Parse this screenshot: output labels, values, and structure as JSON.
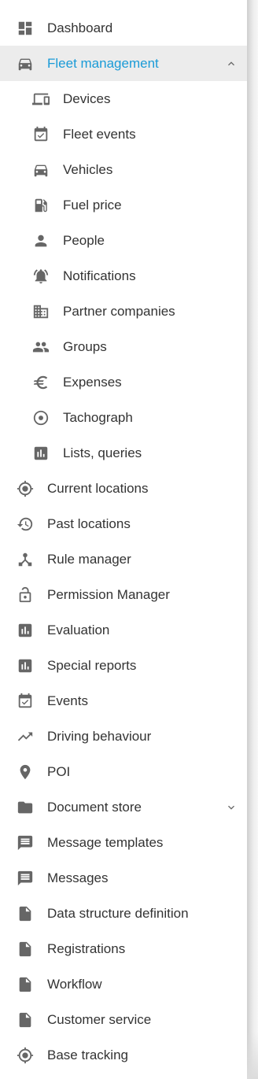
{
  "nav": {
    "items": [
      {
        "label": "Dashboard",
        "icon": "dashboard-icon",
        "level": "top",
        "name": "nav-item-dashboard"
      },
      {
        "label": "Fleet management",
        "icon": "car-icon",
        "level": "top",
        "name": "nav-item-fleet-management",
        "active": true,
        "chevron": "chevron-up-icon"
      },
      {
        "label": "Devices",
        "icon": "devices-icon",
        "level": "sub",
        "name": "nav-item-devices"
      },
      {
        "label": "Fleet events",
        "icon": "event-calendar-icon",
        "level": "sub",
        "name": "nav-item-fleet-events"
      },
      {
        "label": "Vehicles",
        "icon": "car-icon",
        "level": "sub",
        "name": "nav-item-vehicles"
      },
      {
        "label": "Fuel price",
        "icon": "fuel-pump-icon",
        "level": "sub",
        "name": "nav-item-fuel-price"
      },
      {
        "label": "People",
        "icon": "person-icon",
        "level": "sub",
        "name": "nav-item-people"
      },
      {
        "label": "Notifications",
        "icon": "notification-bell-icon",
        "level": "sub",
        "name": "nav-item-notifications"
      },
      {
        "label": "Partner companies",
        "icon": "building-icon",
        "level": "sub",
        "name": "nav-item-partner-companies"
      },
      {
        "label": "Groups",
        "icon": "group-icon",
        "level": "sub",
        "name": "nav-item-groups"
      },
      {
        "label": "Expenses",
        "icon": "euro-icon",
        "level": "sub",
        "name": "nav-item-expenses"
      },
      {
        "label": "Tachograph",
        "icon": "radio-target-icon",
        "level": "sub",
        "name": "nav-item-tachograph"
      },
      {
        "label": "Lists, queries",
        "icon": "bar-chart-icon",
        "level": "sub",
        "name": "nav-item-lists-queries"
      },
      {
        "label": "Current locations",
        "icon": "gps-fixed-icon",
        "level": "top",
        "name": "nav-item-current-locations"
      },
      {
        "label": "Past locations",
        "icon": "history-icon",
        "level": "top",
        "name": "nav-item-past-locations"
      },
      {
        "label": "Rule manager",
        "icon": "hub-icon",
        "level": "top",
        "name": "nav-item-rule-manager"
      },
      {
        "label": "Permission Manager",
        "icon": "lock-open-icon",
        "level": "top",
        "name": "nav-item-permission-manager"
      },
      {
        "label": "Evaluation",
        "icon": "bar-chart-icon",
        "level": "top",
        "name": "nav-item-evaluation"
      },
      {
        "label": "Special reports",
        "icon": "bar-chart-icon",
        "level": "top",
        "name": "nav-item-special-reports"
      },
      {
        "label": "Events",
        "icon": "event-calendar-icon",
        "level": "top",
        "name": "nav-item-events"
      },
      {
        "label": "Driving behaviour",
        "icon": "trending-up-icon",
        "level": "top",
        "name": "nav-item-driving-behaviour"
      },
      {
        "label": "POI",
        "icon": "map-pin-icon",
        "level": "top",
        "name": "nav-item-poi"
      },
      {
        "label": "Document store",
        "icon": "folder-icon",
        "level": "top",
        "name": "nav-item-document-store",
        "chevron": "chevron-down-icon"
      },
      {
        "label": "Message templates",
        "icon": "message-icon",
        "level": "top",
        "name": "nav-item-message-templates"
      },
      {
        "label": "Messages",
        "icon": "message-icon",
        "level": "top",
        "name": "nav-item-messages"
      },
      {
        "label": "Data structure definition",
        "icon": "file-icon",
        "level": "top",
        "name": "nav-item-data-structure-definition"
      },
      {
        "label": "Registrations",
        "icon": "file-icon",
        "level": "top",
        "name": "nav-item-registrations"
      },
      {
        "label": "Workflow",
        "icon": "file-icon",
        "level": "top",
        "name": "nav-item-workflow"
      },
      {
        "label": "Customer service",
        "icon": "file-icon",
        "level": "top",
        "name": "nav-item-customer-service"
      },
      {
        "label": "Base tracking",
        "icon": "gps-fixed-icon",
        "level": "top",
        "name": "nav-item-base-tracking"
      }
    ]
  },
  "colors": {
    "active_text": "#1a9bd7",
    "active_background": "#ececec",
    "active_icon": "#666666",
    "icon": "#666666",
    "text": "#333333"
  }
}
